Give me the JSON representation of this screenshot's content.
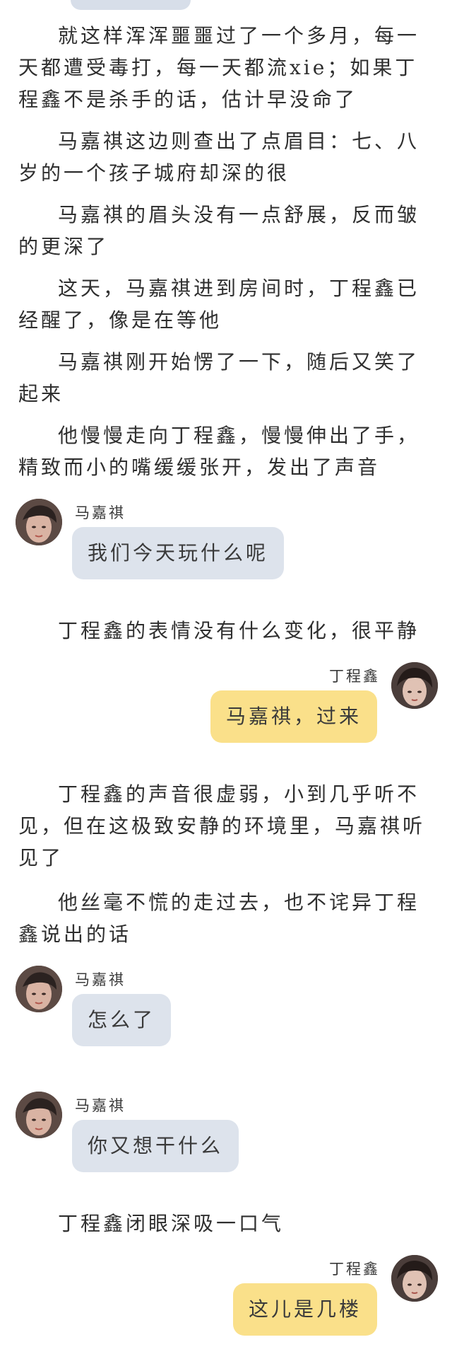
{
  "paragraphs_top": [
    "就这样浑浑噩噩过了一个多月，每一天都遭受毒打，每一天都流xie；如果丁程鑫不是杀手的话，估计早没命了",
    "马嘉祺这边则查出了点眉目：七、八岁的一个孩子城府却深的很",
    "马嘉祺的眉头没有一点舒展，反而皱的更深了",
    "这天，马嘉祺进到房间时，丁程鑫已经醒了，像是在等他",
    "马嘉祺刚开始愣了一下，随后又笑了起来",
    "他慢慢走向丁程鑫，慢慢伸出了手，精致而小的嘴缓缓张开，发出了声音"
  ],
  "chat": {
    "msg1": {
      "sender": "马嘉祺",
      "text": "我们今天玩什么呢"
    },
    "narr1": "丁程鑫的表情没有什么变化，很平静",
    "msg2": {
      "sender": "丁程鑫",
      "text": "马嘉祺，过来"
    },
    "narr2": "丁程鑫的声音很虚弱，小到几乎听不见，但在这极致安静的环境里，马嘉祺听见了",
    "narr3": "他丝毫不慌的走过去，也不诧异丁程鑫说出的话",
    "msg3": {
      "sender": "马嘉祺",
      "text": "怎么了"
    },
    "msg4": {
      "sender": "马嘉祺",
      "text": "你又想干什么"
    },
    "narr4": "丁程鑫闭眼深吸一口气",
    "msg5": {
      "sender": "丁程鑫",
      "text": "这儿是几楼"
    }
  },
  "colors": {
    "left_bubble": "#dde3ec",
    "right_bubble": "#fae08a",
    "text": "#2f2f2f"
  },
  "icons": {
    "avatar_left": "avatar-photo",
    "avatar_right": "avatar-photo"
  }
}
